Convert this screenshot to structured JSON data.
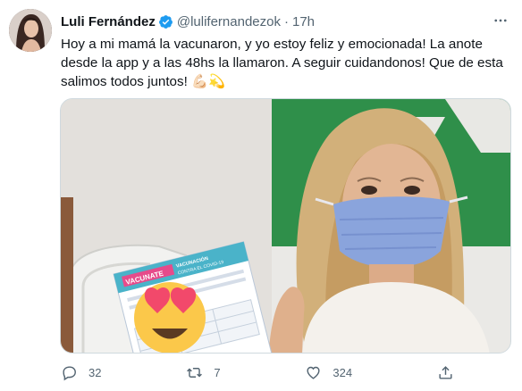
{
  "tweet": {
    "author_name": "Luli Fernández",
    "handle": "@lulifernandezok",
    "separator": "·",
    "time": "17h",
    "text": "Hoy a mi mamá la vacunaron, y yo estoy feliz y emocionada! La anote desde la app y a las 48hs la llamaron. A seguir cuidandonos! Que de esta salimos todos juntos! 💪🏻💫",
    "media_alt_icons": [
      "verified-badge-icon",
      "more-icon"
    ],
    "card_text": {
      "line1": "VACUNATE",
      "line2": "VACUNACIÓN",
      "line3": "CONTRA EL COVID-19"
    },
    "stats": {
      "replies": "32",
      "retweets": "7",
      "likes": "324"
    },
    "accent_color": "#1d9bf0"
  }
}
